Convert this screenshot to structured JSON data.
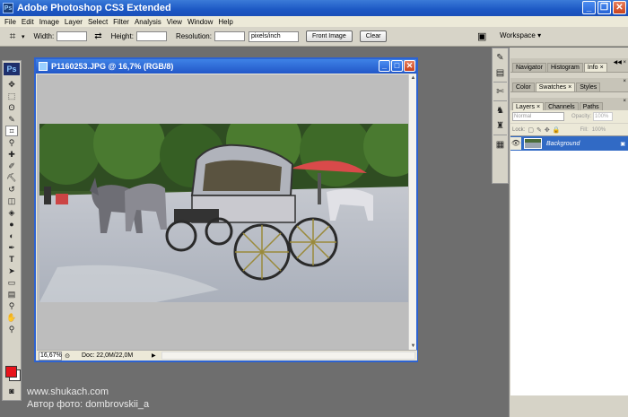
{
  "window": {
    "title": "Adobe Photoshop CS3 Extended"
  },
  "menu": [
    "File",
    "Edit",
    "Image",
    "Layer",
    "Select",
    "Filter",
    "Analysis",
    "View",
    "Window",
    "Help"
  ],
  "options": {
    "width_label": "Width:",
    "height_label": "Height:",
    "resolution_label": "Resolution:",
    "units": "pixels/inch",
    "front_image": "Front Image",
    "clear": "Clear",
    "workspace": "Workspace"
  },
  "toolbox": {
    "logo": "Ps"
  },
  "document": {
    "title": "P1160253.JPG @ 16,7% (RGB/8)",
    "zoom": "16,67%",
    "doc_info": "Doc: 22,0M/22,0M"
  },
  "panels": {
    "group1": [
      "Navigator",
      "Histogram",
      "Info"
    ],
    "group2": [
      "Color",
      "Swatches",
      "Styles"
    ],
    "group3": [
      "Layers",
      "Channels",
      "Paths"
    ],
    "blend_mode": "Normal",
    "opacity_label": "Opacity:",
    "opacity_value": "100%",
    "lock_label": "Lock:",
    "fill_label": "Fill:",
    "fill_value": "100%",
    "layer_name": "Background"
  },
  "watermark": {
    "line1": "www.shukach.com",
    "line2": "Автор фото: dombrovskii_a"
  },
  "colors": {
    "foreground": "#e8141c",
    "background": "#ffffff",
    "title_blue": "#1c58c4",
    "selection": "#316ac5"
  },
  "icons": {
    "toolbox": [
      "move-icon",
      "marquee-icon",
      "lasso-icon",
      "quick-select-icon",
      "crop-icon",
      "eyedropper-icon",
      "heal-icon",
      "brush-icon",
      "stamp-icon",
      "history-brush-icon",
      "eraser-icon",
      "bucket-icon",
      "blur-icon",
      "dodge-icon",
      "pen-icon",
      "type-icon",
      "path-select-icon",
      "shape-icon",
      "notes-icon",
      "eyedropper2-icon",
      "hand-icon",
      "zoom-icon"
    ]
  }
}
